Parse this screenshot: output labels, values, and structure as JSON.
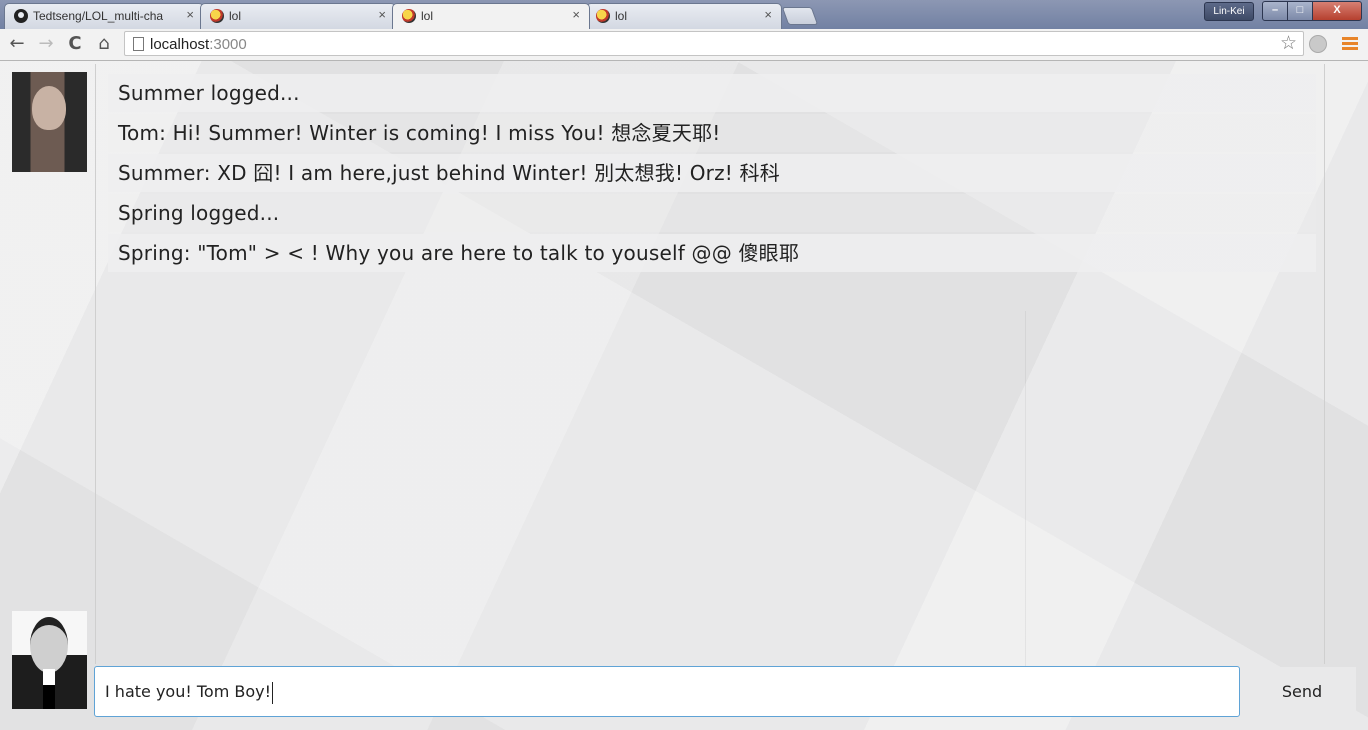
{
  "browser": {
    "tabs": [
      {
        "title": "Tedtseng/LOL_multi-chat-",
        "favicon": "github-icon"
      },
      {
        "title": "lol",
        "favicon": "troll-face-icon"
      },
      {
        "title": "lol",
        "favicon": "troll-face-icon",
        "active": true
      },
      {
        "title": "lol",
        "favicon": "troll-face-icon"
      }
    ],
    "tab_close_glyph": "×",
    "user_badge": "Lin-Kei",
    "window_buttons": {
      "minimize": "–",
      "maximize": "□",
      "close": "X"
    },
    "nav": {
      "back": "←",
      "forward": "→",
      "reload": "C",
      "home": "⌂"
    },
    "address": {
      "host": "localhost",
      "port": ":3000"
    },
    "star_glyph": "☆"
  },
  "chat": {
    "messages": [
      "Summer logged...",
      "Tom: Hi! Summer! Winter is coming! I miss You! 想念夏天耶!",
      "Summer: XD 囧! I am here,just behind Winter! 別太想我! Orz! 科科",
      "Spring logged...",
      "Spring: \"Tom\" > < ! Why you are here to talk to youself @@ 傻眼耶"
    ]
  },
  "composer": {
    "input_value": "I hate you! Tom Boy!",
    "send_label": "Send"
  },
  "colors": {
    "input_focus_border": "#5fa3d6",
    "menu_icon": "#e8852a",
    "paper_background": "#e9e9ea"
  }
}
